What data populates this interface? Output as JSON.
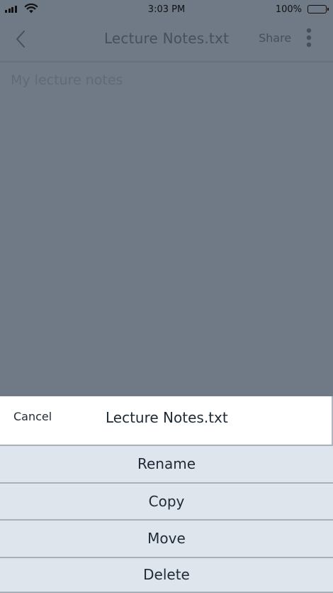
{
  "status_bar": {
    "time": "3:03 PM",
    "battery_percent": "100%",
    "battery_level": 1.0
  },
  "nav": {
    "title": "Lecture Notes.txt",
    "share_label": "Share",
    "back_icon": "chevron-left-icon",
    "more_icon": "vertical-ellipsis-icon"
  },
  "editor": {
    "placeholder": "My lecture notes"
  },
  "sheet": {
    "cancel_label": "Cancel",
    "title": "Lecture Notes.txt",
    "options": [
      {
        "label": "Rename"
      },
      {
        "label": "Copy"
      },
      {
        "label": "Move"
      },
      {
        "label": "Delete"
      }
    ]
  },
  "colors": {
    "overlay": "#6f7a86",
    "sheet_option_bg": "#dfe5ec",
    "sheet_header_bg": "#ffffff",
    "text_dark": "#1f2a36"
  }
}
